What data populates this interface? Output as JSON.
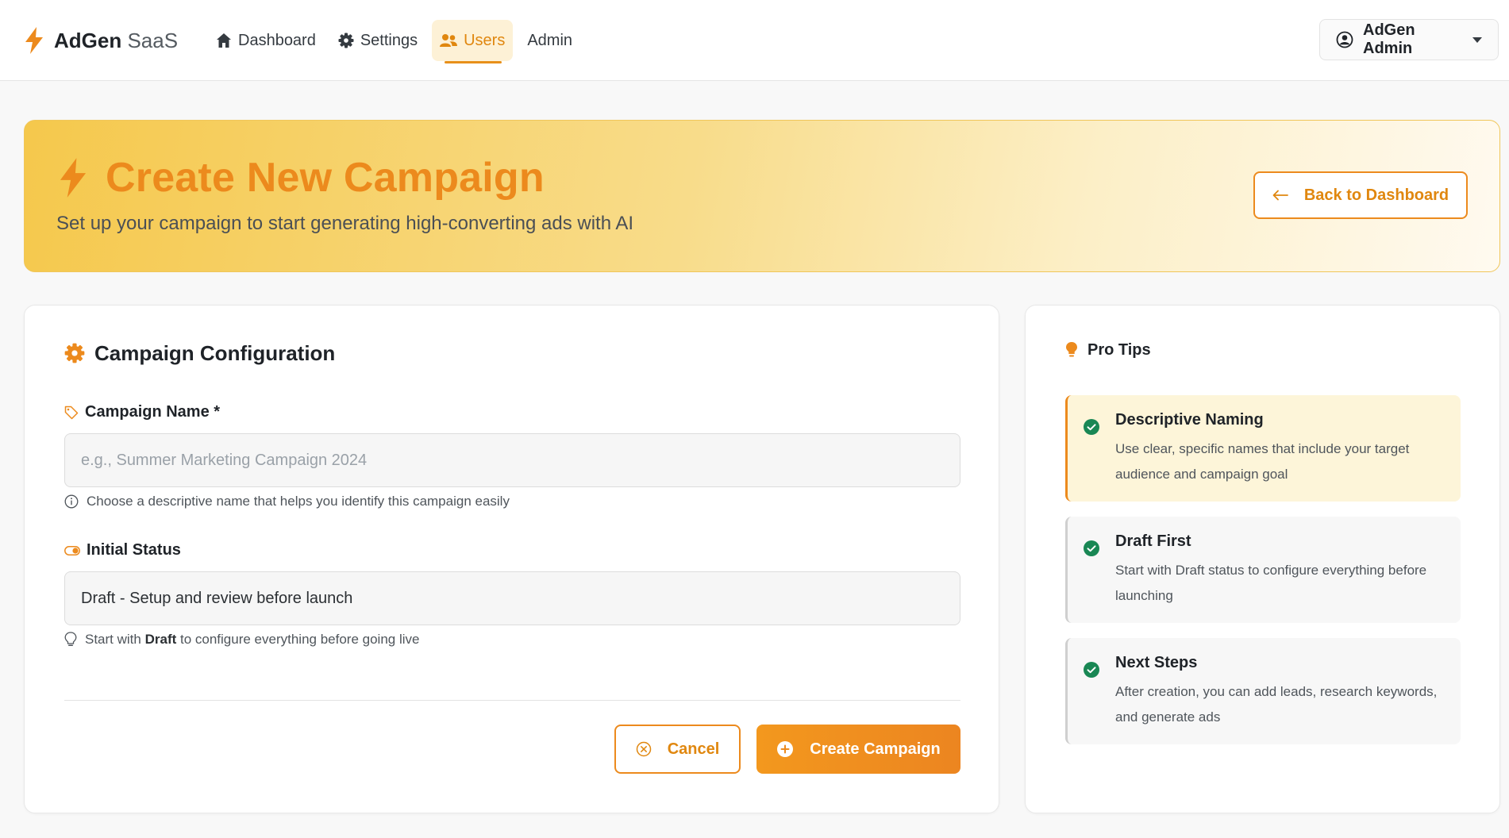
{
  "brand": {
    "name_bold": "AdGen",
    "name_light": "SaaS",
    "icon": "lightning-icon"
  },
  "nav": {
    "items": [
      {
        "label": "Dashboard",
        "icon": "home-icon",
        "active": false
      },
      {
        "label": "Settings",
        "icon": "gear-icon",
        "active": false
      },
      {
        "label": "Users",
        "icon": "users-icon",
        "active": true
      },
      {
        "label": "Admin",
        "icon": "",
        "active": false
      }
    ]
  },
  "user_menu": {
    "label": "AdGen Admin",
    "icon": "user-circle-icon"
  },
  "hero": {
    "title": "Create New Campaign",
    "subtitle": "Set up your campaign to start generating high-converting ads with AI",
    "back_button": "Back to Dashboard"
  },
  "config": {
    "title": "Campaign Configuration",
    "name_field": {
      "label": "Campaign Name *",
      "placeholder": "e.g., Summer Marketing Campaign 2024",
      "value": "",
      "help": "Choose a descriptive name that helps you identify this campaign easily"
    },
    "status_field": {
      "label": "Initial Status",
      "value": "Draft - Setup and review before launch",
      "help_prefix": "Start with",
      "help_bold": "Draft",
      "help_suffix": "to configure everything before going live"
    },
    "cancel_button": "Cancel",
    "create_button": "Create Campaign"
  },
  "tips": {
    "title": "Pro Tips",
    "items": [
      {
        "title": "Descriptive Naming",
        "body": "Use clear, specific names that include your target audience and campaign goal",
        "highlighted": true
      },
      {
        "title": "Draft First",
        "body": "Start with Draft status to configure everything before launching",
        "highlighted": false
      },
      {
        "title": "Next Steps",
        "body": "After creation, you can add leads, research keywords, and generate ads",
        "highlighted": false
      }
    ]
  },
  "colors": {
    "accent": "#ec8a1d",
    "success": "#198754",
    "hero_start": "#f5c84c"
  }
}
